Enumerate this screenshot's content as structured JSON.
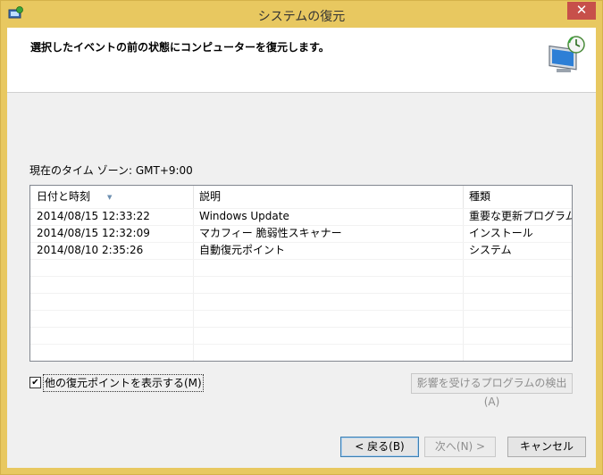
{
  "window": {
    "title": "システムの復元"
  },
  "header": {
    "text": "選択したイベントの前の状態にコンピューターを復元します。"
  },
  "timezone": {
    "label": "現在のタイム ゾーン: GMT+9:00"
  },
  "list": {
    "columns": [
      "日付と時刻",
      "説明",
      "種類"
    ],
    "rows": [
      [
        "2014/08/15 12:33:22",
        "Windows Update",
        "重要な更新プログラム"
      ],
      [
        "2014/08/15 12:32:09",
        "マカフィー 脆弱性スキャナー",
        "インストール"
      ],
      [
        "2014/08/10 2:35:26",
        "自動復元ポイント",
        "システム"
      ]
    ]
  },
  "show_more": {
    "label": "他の復元ポイントを表示する(M)",
    "checked": true
  },
  "buttons": {
    "scan": "影響を受けるプログラムの検出(A)",
    "back": "< 戻る(B)",
    "next": "次へ(N) >",
    "cancel": "キャンセル"
  },
  "icons": {
    "app": "system-restore-icon",
    "header": "computer-restore-icon",
    "close": "close-icon"
  }
}
